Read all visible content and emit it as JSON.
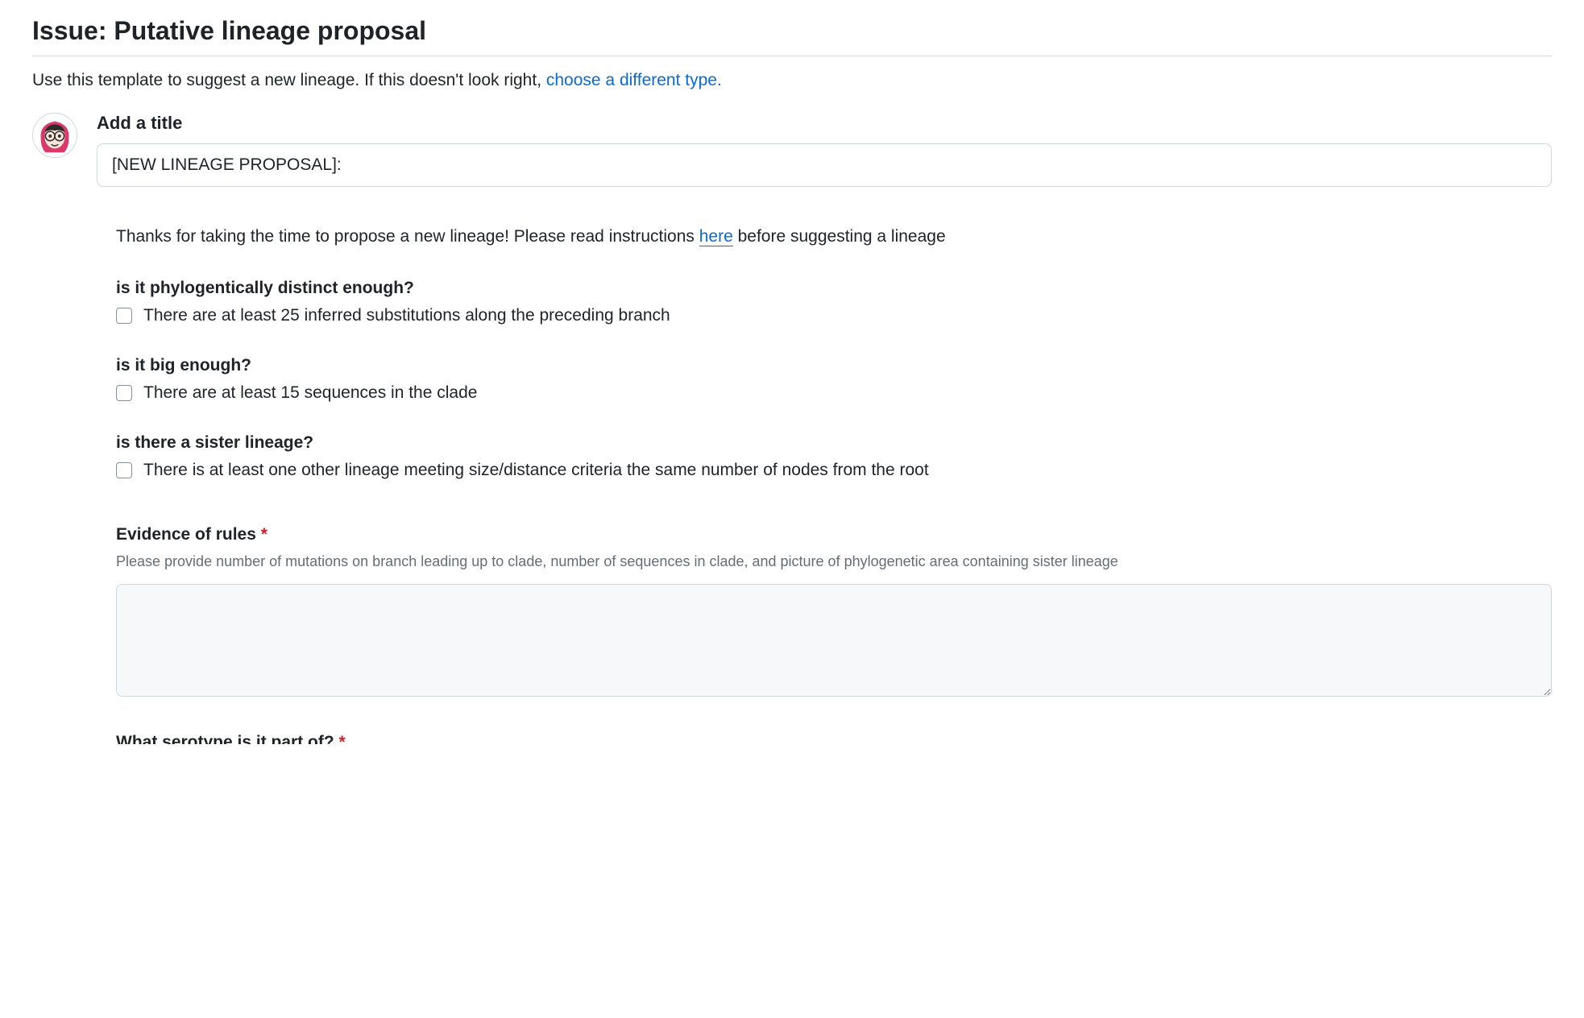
{
  "page": {
    "title": "Issue: Putative lineage proposal",
    "subtitle_prefix": "Use this template to suggest a new lineage. If this doesn't look right, ",
    "subtitle_link": "choose a different type."
  },
  "title_section": {
    "label": "Add a title",
    "value": "[NEW LINEAGE PROPOSAL]:"
  },
  "intro": {
    "text_before": "Thanks for taking the time to propose a new lineage! Please read instructions ",
    "link_text": "here",
    "text_after": " before suggesting a lineage"
  },
  "questions": [
    {
      "heading": "is it phylogentically distinct enough?",
      "checkbox_label": "There are at least 25 inferred substitutions along the preceding branch",
      "checked": false
    },
    {
      "heading": "is it big enough?",
      "checkbox_label": "There are at least 15 sequences in the clade",
      "checked": false
    },
    {
      "heading": "is there a sister lineage?",
      "checkbox_label": "There is at least one other lineage meeting size/distance criteria the same number of nodes from the root",
      "checked": false
    }
  ],
  "evidence": {
    "label": "Evidence of rules",
    "required": true,
    "help": "Please provide number of mutations on branch leading up to clade, number of sequences in clade, and picture of phylogenetic area containing sister lineage",
    "value": ""
  },
  "cutoff_field": {
    "label": "What serotype is it part of?",
    "required": true
  }
}
